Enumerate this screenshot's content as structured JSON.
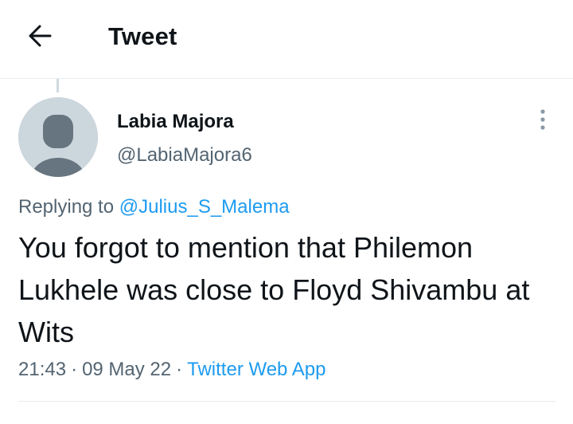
{
  "header": {
    "title": "Tweet",
    "back_icon": "arrow-left-icon"
  },
  "tweet": {
    "author": {
      "name": "Labia Majora",
      "handle": "@LabiaMajora6",
      "avatar": "default-avatar-silhouette"
    },
    "more_icon": "vertical-ellipsis-icon",
    "replying_to_label": "Replying to",
    "replying_to_handle": "@Julius_S_Malema",
    "text": "You forgot to mention that Philemon Lukhele was close to Floyd Shivambu at Wits",
    "time": "21:43",
    "date": "09 May 22",
    "separator": "·",
    "source": "Twitter Web App"
  },
  "colors": {
    "text_primary": "#0f1419",
    "text_secondary": "#536471",
    "link": "#1d9bf0",
    "avatar_bg": "#ccd6dd",
    "avatar_fg": "#66757f",
    "divider": "#e6ecf0"
  }
}
